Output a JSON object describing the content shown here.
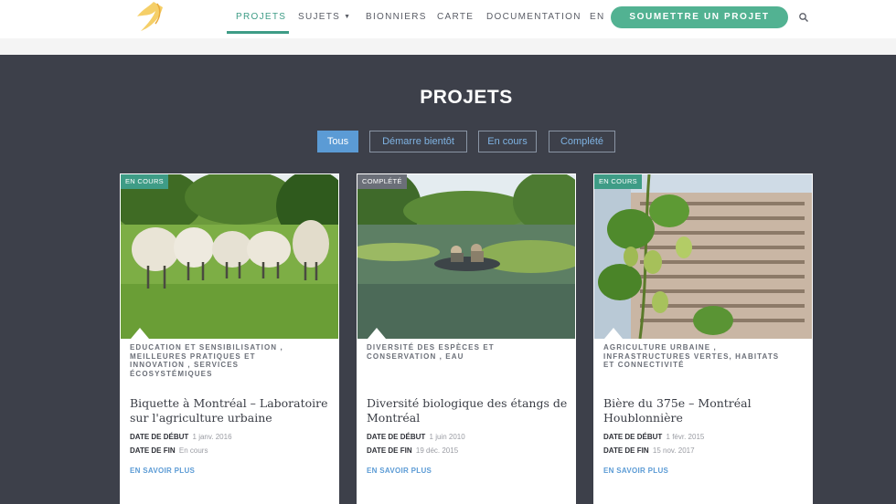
{
  "header": {
    "nav": [
      {
        "label": "PROJETS",
        "active": true
      },
      {
        "label": "SUJETS",
        "has_dropdown": true
      },
      {
        "label": "BIONNIERS"
      },
      {
        "label": "CARTE"
      },
      {
        "label": "DOCUMENTATION"
      },
      {
        "label": "EN"
      }
    ],
    "submit_label": "SOUMETTRE UN PROJET",
    "search_icon": "search-icon",
    "accent_color": "#52b292"
  },
  "page": {
    "title": "PROJETS",
    "filters": [
      {
        "label": "Tous",
        "active": true
      },
      {
        "label": "Démarre bientôt"
      },
      {
        "label": "En cours"
      },
      {
        "label": "Complété"
      }
    ]
  },
  "cards": [
    {
      "status": "EN COURS",
      "status_color": "#3e9c86",
      "image": "sheep-on-grass-photo",
      "tags": "EDUCATION ET SENSIBILISATION , MEILLEURES PRATIQUES ET INNOVATION , SERVICES ÉCOSYSTÉMIQUES",
      "title": "Biquette à Montréal – Laboratoire sur l'agriculture urbaine",
      "start_label": "DATE DE DÉBUT",
      "start_value": "1 janv. 2016",
      "end_label": "DATE DE FIN",
      "end_value": "En cours",
      "more_label": "EN SAVOIR PLUS"
    },
    {
      "status": "COMPLÉTÉ",
      "status_color": "#6b6f78",
      "image": "pond-boat-photo",
      "tags": "DIVERSITÉ DES ESPÈCES ET CONSERVATION , EAU",
      "title": "Diversité biologique des étangs de Montréal",
      "start_label": "DATE DE DÉBUT",
      "start_value": "1 juin 2010",
      "end_label": "DATE DE FIN",
      "end_value": "19 déc. 2015",
      "more_label": "EN SAVOIR PLUS"
    },
    {
      "status": "EN COURS",
      "status_color": "#3e9c86",
      "image": "hops-and-building-photo",
      "tags": "AGRICULTURE URBAINE , INFRASTRUCTURES VERTES, HABITATS ET CONNECTIVITÉ",
      "title": "Bière du 375e – Montréal Houblonnière",
      "start_label": "DATE DE DÉBUT",
      "start_value": "1 févr. 2015",
      "end_label": "DATE DE FIN",
      "end_value": "15 nov. 2017",
      "more_label": "EN SAVOIR PLUS"
    }
  ]
}
